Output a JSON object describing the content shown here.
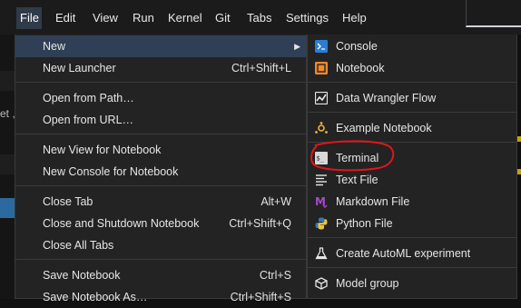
{
  "menubar": {
    "items": [
      "File",
      "Edit",
      "View",
      "Run",
      "Kernel",
      "Git",
      "Tabs",
      "Settings",
      "Help"
    ]
  },
  "background": {
    "fragment_text": "et ,"
  },
  "file_menu": {
    "items": [
      {
        "label": "New",
        "shortcut": "",
        "has_submenu": true
      },
      {
        "label": "New Launcher",
        "shortcut": "Ctrl+Shift+L"
      },
      {
        "label": "Open from Path…",
        "shortcut": ""
      },
      {
        "label": "Open from URL…",
        "shortcut": ""
      },
      {
        "label": "New View for Notebook",
        "shortcut": ""
      },
      {
        "label": "New Console for Notebook",
        "shortcut": ""
      },
      {
        "label": "Close Tab",
        "shortcut": "Alt+W"
      },
      {
        "label": "Close and Shutdown Notebook",
        "shortcut": "Ctrl+Shift+Q"
      },
      {
        "label": "Close All Tabs",
        "shortcut": ""
      },
      {
        "label": "Save Notebook",
        "shortcut": "Ctrl+S"
      },
      {
        "label": "Save Notebook As…",
        "shortcut": "Ctrl+Shift+S"
      }
    ]
  },
  "new_menu": {
    "items": [
      {
        "label": "Console",
        "icon": "console-icon"
      },
      {
        "label": "Notebook",
        "icon": "notebook-icon"
      },
      {
        "label": "Data Wrangler Flow",
        "icon": "data-wrangler-icon"
      },
      {
        "label": "Example Notebook",
        "icon": "example-notebook-icon"
      },
      {
        "label": "Terminal",
        "icon": "terminal-icon"
      },
      {
        "label": "Text File",
        "icon": "text-file-icon"
      },
      {
        "label": "Markdown File",
        "icon": "markdown-icon"
      },
      {
        "label": "Python File",
        "icon": "python-icon"
      },
      {
        "label": "Create AutoML experiment",
        "icon": "flask-icon"
      },
      {
        "label": "Model group",
        "icon": "cube-icon"
      }
    ]
  },
  "colors": {
    "accent": "#2f3f55",
    "annotation_circle": "#e0161b",
    "console_icon": "#2a7fd4",
    "notebook_icon": "#f0882c",
    "markdown_icon": "#a34bc8",
    "python_blue": "#3a75b0",
    "python_yellow": "#f0c43a"
  }
}
